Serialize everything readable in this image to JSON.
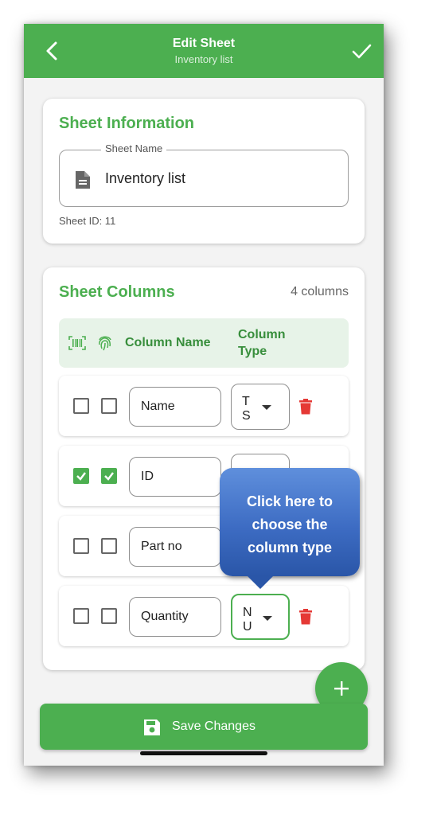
{
  "appbar": {
    "title": "Edit Sheet",
    "subtitle": "Inventory list",
    "back_icon": "chevron-left-icon",
    "confirm_icon": "check-icon"
  },
  "sheet_info": {
    "title": "Sheet Information",
    "name_label": "Sheet Name",
    "name_value": "Inventory list",
    "sheet_id_text": "Sheet ID: 11"
  },
  "sheet_columns": {
    "title": "Sheet Columns",
    "count_text": "4 columns",
    "header": {
      "barcode_icon": "barcode-icon",
      "fingerprint_icon": "fingerprint-icon",
      "column_name": "Column Name",
      "column_type": "Column Type"
    },
    "rows": [
      {
        "name": "Name",
        "barcode": false,
        "unique": false,
        "type_value": "T\nS",
        "type_visible": true
      },
      {
        "name": "ID",
        "barcode": true,
        "unique": true,
        "type_value": "",
        "type_visible": true
      },
      {
        "name": "Part no",
        "barcode": false,
        "unique": false,
        "type_value": "",
        "type_visible": false
      },
      {
        "name": "Quantity",
        "barcode": false,
        "unique": false,
        "type_value": "N\nU",
        "type_visible": true
      }
    ]
  },
  "tooltip": {
    "text": "Click here to choose the column type"
  },
  "fab": {
    "icon": "plus-icon"
  },
  "save_button": {
    "label": "Save Changes",
    "icon": "floppy-disk-icon"
  },
  "colors": {
    "primary": "#4caf50",
    "delete": "#e53935",
    "tooltip": "#3d6cc3"
  }
}
